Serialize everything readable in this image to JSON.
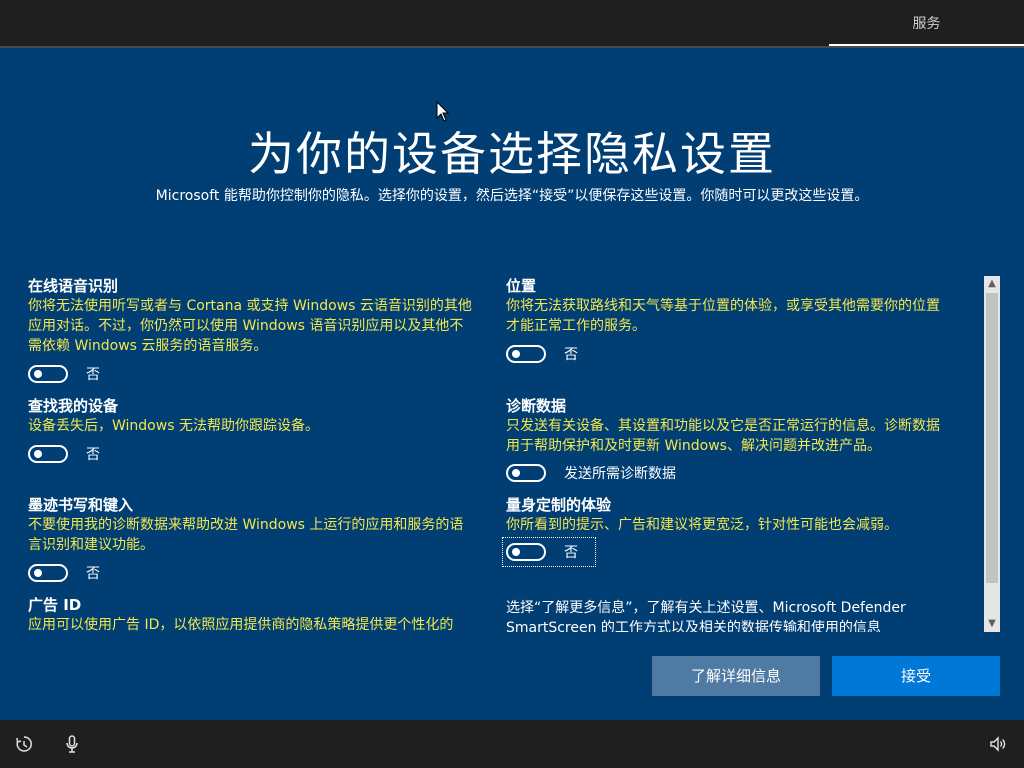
{
  "header": {
    "step_label": "服务"
  },
  "page": {
    "title": "为你的设备选择隐私设置",
    "subtitle": "Microsoft 能帮助你控制你的隐私。选择你的设置，然后选择“接受”以便保存这些设置。你随时可以更改这些设置。"
  },
  "settings_left": [
    {
      "name": "在线语音识别",
      "desc_lines": [
        "你将无法使用听写或者与 Cortana 或支持 Windows 云语音识别的其他",
        "应用对话。不过，你仍然可以使用 Windows 语音识别应用以及其他不",
        "需依赖 Windows 云服务的语音服务。"
      ],
      "toggle_label": "否"
    },
    {
      "name": "查找我的设备",
      "desc_lines": [
        "设备丢失后，Windows 无法帮助你跟踪设备。"
      ],
      "toggle_label": "否"
    },
    {
      "name": "墨迹书写和键入",
      "desc_lines": [
        "不要使用我的诊断数据来帮助改进 Windows 上运行的应用和服务的语",
        "言识别和建议功能。"
      ],
      "toggle_label": "否"
    },
    {
      "name": "广告 ID",
      "desc_lines": [
        "应用可以使用广告 ID，以依照应用提供商的隐私策略提供更个性化的"
      ]
    }
  ],
  "settings_right": [
    {
      "name": "位置",
      "desc_lines": [
        "你将无法获取路线和天气等基于位置的体验，或享受其他需要你的位置",
        "才能正常工作的服务。"
      ],
      "toggle_label": "否"
    },
    {
      "name": "诊断数据",
      "desc_lines": [
        "只发送有关设备、其设置和功能以及它是否正常运行的信息。诊断数据",
        "用于帮助保护和及时更新 Windows、解决问题并改进产品。"
      ],
      "toggle_label": "发送所需诊断数据"
    },
    {
      "name": "量身定制的体验",
      "desc_lines": [
        "你所看到的提示、广告和建议将更宽泛，针对性可能也会减弱。"
      ],
      "toggle_label": "否"
    }
  ],
  "note_lines": [
    "选择“了解更多信息”，了解有关上述设置、Microsoft Defender",
    "SmartScreen 的工作方式以及相关的数据传输和使用的信息"
  ],
  "buttons": {
    "learn_more": "了解详细信息",
    "accept": "接受"
  },
  "colors": {
    "background": "#003e74",
    "description_text": "#f2e84e",
    "accept_button": "#0078d7",
    "learn_more_button": "#4f7aa3"
  },
  "icons": [
    "cursor-icon",
    "ease-of-access-icon",
    "microphone-icon",
    "volume-icon",
    "scroll-up-icon",
    "scroll-down-icon"
  ]
}
